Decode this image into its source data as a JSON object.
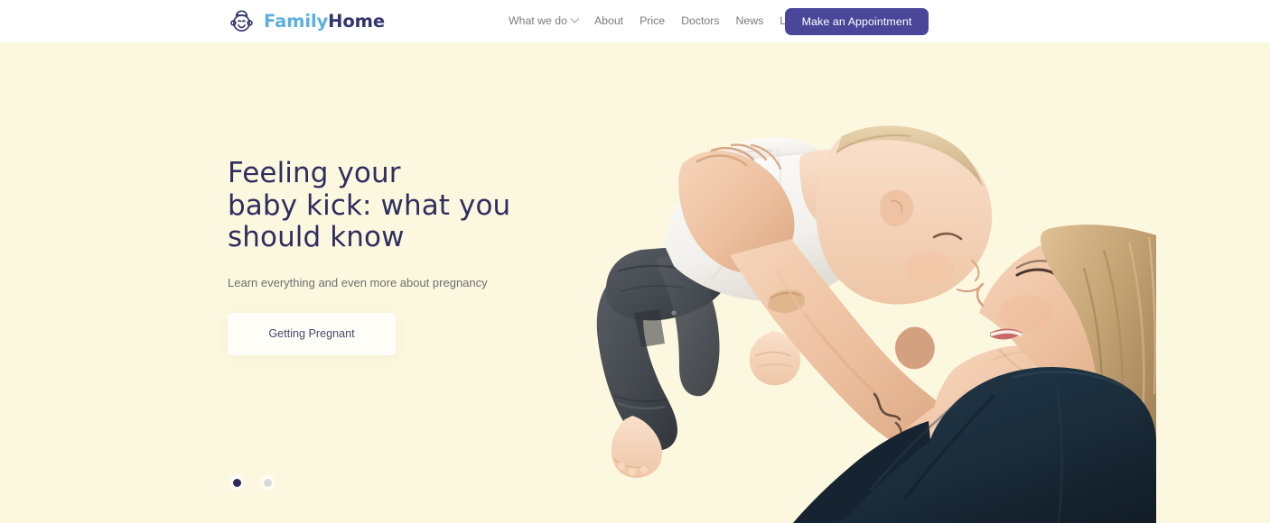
{
  "header": {
    "logo": {
      "icon": "baby-face-icon",
      "word1": "Family",
      "word2": "Home",
      "color1": "#5bb0e0",
      "color2": "#32356b"
    },
    "nav": [
      {
        "label": "What we do",
        "has_caret": true,
        "icon": "chevron-down-icon"
      },
      {
        "label": "About",
        "has_caret": false,
        "icon": ""
      },
      {
        "label": "Price",
        "has_caret": false,
        "icon": ""
      },
      {
        "label": "Doctors",
        "has_caret": false,
        "icon": ""
      },
      {
        "label": "News",
        "has_caret": false,
        "icon": ""
      },
      {
        "label": "Location",
        "has_caret": false,
        "icon": ""
      }
    ],
    "appointment_button": {
      "label": "Make an Appointment",
      "bg": "#4a479b",
      "text_color": "#ffffff"
    }
  },
  "hero": {
    "background_color": "#fcf8e0",
    "title": "Feeling your\nbaby kick: what you\nshould know",
    "title_color": "#2e2e5f",
    "subtitle": "Learn everything and even more about pregnancy",
    "subtitle_color": "#6e6e6e",
    "cta": {
      "label": "Getting Pregnant",
      "bg": "#fffdf8",
      "text_color": "#4a4a6a"
    },
    "carousel": {
      "dots": [
        {
          "name": "slide-1",
          "active": true,
          "color": "#2c2c5c"
        },
        {
          "name": "slide-2",
          "active": false,
          "color": "#d8d8d8"
        }
      ]
    },
    "image": {
      "name": "mother-lifting-baby-photo",
      "alt": "Smiling mother holding baby up in the air, nose to nose",
      "colors": {
        "skin": "#f0c7a8",
        "skin_shadow": "#dda987",
        "baby_skin": "#f5d3b8",
        "hair": "#c9a876",
        "hair_dark": "#a0804f",
        "shirt": "#1d2f3d",
        "onesie": "#fbfbfb",
        "jeans": "#4b4f55",
        "jeans_dark": "#353a40"
      }
    }
  }
}
